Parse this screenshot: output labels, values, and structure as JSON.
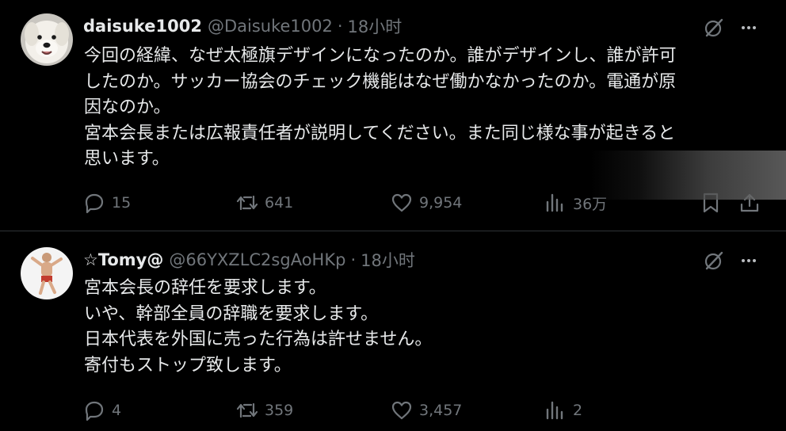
{
  "tweets": [
    {
      "name": "daisuke1002",
      "handle": "@Daisuke1002",
      "separator": "·",
      "time": "18小时",
      "lines": [
        "今回の経緯、なぜ太極旗デザインになったのか。誰がデザインし、誰が許可",
        "したのか。サッカー協会のチェック機能はなぜ働かなかったのか。電通が原",
        "因なのか。",
        "宮本会長または広報責任者が説明してください。また同じ様な事が起きると",
        "思います。"
      ],
      "replies": "15",
      "retweets": "641",
      "likes": "9,954",
      "views": "36万"
    },
    {
      "name": "☆Tomy@",
      "handle": "@66YXZLC2sgAoHKp",
      "separator": "·",
      "time": "18小时",
      "lines": [
        "宮本会長の辞任を要求します。",
        "いや、幹部全員の辞職を要求します。",
        "日本代表を外国に売った行為は許せません。",
        "寄付もストップ致します。"
      ],
      "replies": "4",
      "retweets": "359",
      "likes": "3,457",
      "views": "2"
    }
  ],
  "icons": [
    "reply-icon",
    "retweet-icon",
    "like-icon",
    "views-icon",
    "bookmark-icon",
    "share-icon",
    "grok-icon",
    "more-icon"
  ],
  "colors": {
    "background": "#000000",
    "text": "#e7e9ea",
    "secondary": "#71767b",
    "divider": "#2f3336"
  }
}
